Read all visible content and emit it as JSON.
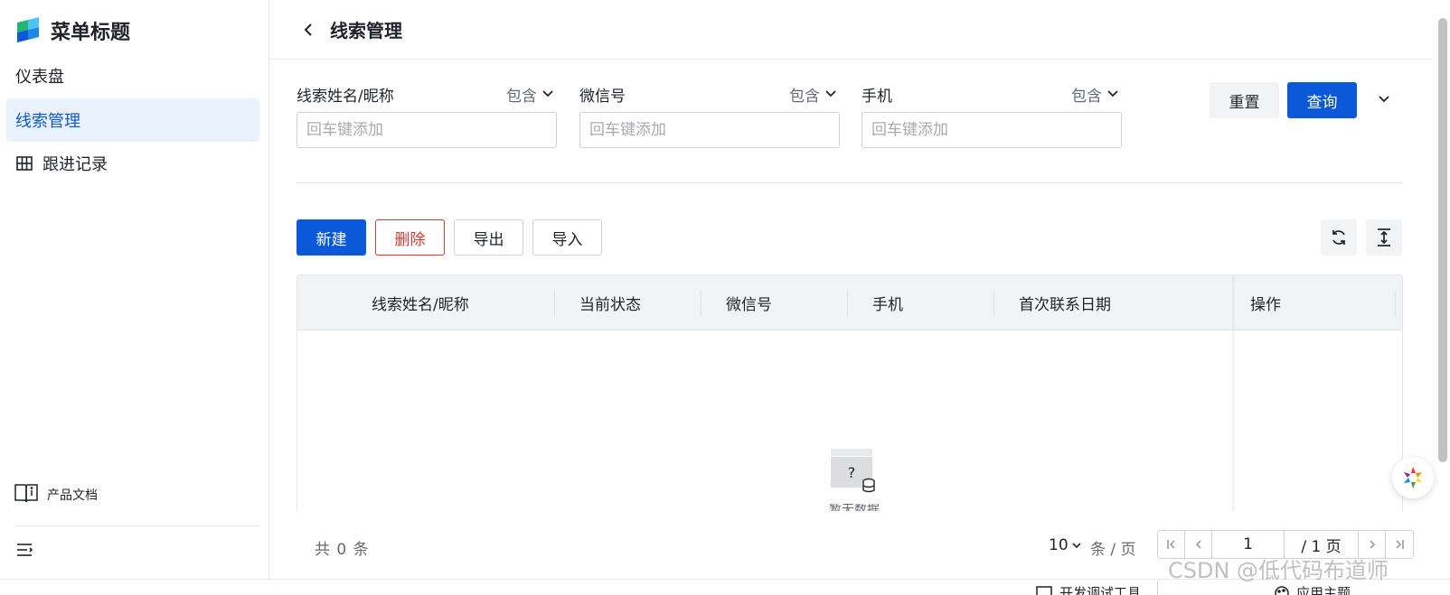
{
  "sidebar": {
    "title": "菜单标题",
    "items": [
      {
        "label": "仪表盘"
      },
      {
        "label": "线索管理"
      },
      {
        "label": "跟进记录"
      }
    ],
    "doc_link": "产品文档"
  },
  "header": {
    "title": "线索管理"
  },
  "filters": [
    {
      "label": "线索姓名/昵称",
      "operator": "包含",
      "placeholder": "回车键添加"
    },
    {
      "label": "微信号",
      "operator": "包含",
      "placeholder": "回车键添加"
    },
    {
      "label": "手机",
      "operator": "包含",
      "placeholder": "回车键添加"
    }
  ],
  "filter_actions": {
    "reset": "重置",
    "query": "查询"
  },
  "toolbar": {
    "new": "新建",
    "delete": "删除",
    "export": "导出",
    "import": "导入"
  },
  "table": {
    "columns": [
      "线索姓名/昵称",
      "当前状态",
      "微信号",
      "手机",
      "首次联系日期",
      "操作"
    ],
    "rows": [],
    "empty_glyph": "?",
    "empty_text": "暂无数据"
  },
  "pagination": {
    "total_text": "共 0 条",
    "page_size": "10",
    "page_size_unit": "条 / 页",
    "current_page": "1",
    "total_pages_text": "/ 1 页"
  },
  "bottom_bar": {
    "dev_tools": "开发调试工具",
    "theme": "应用主题"
  },
  "watermark": "CSDN @低代码布道师",
  "colors": {
    "primary": "#0b58d8",
    "danger": "#d83931",
    "active_bg": "#eaf2fe"
  }
}
